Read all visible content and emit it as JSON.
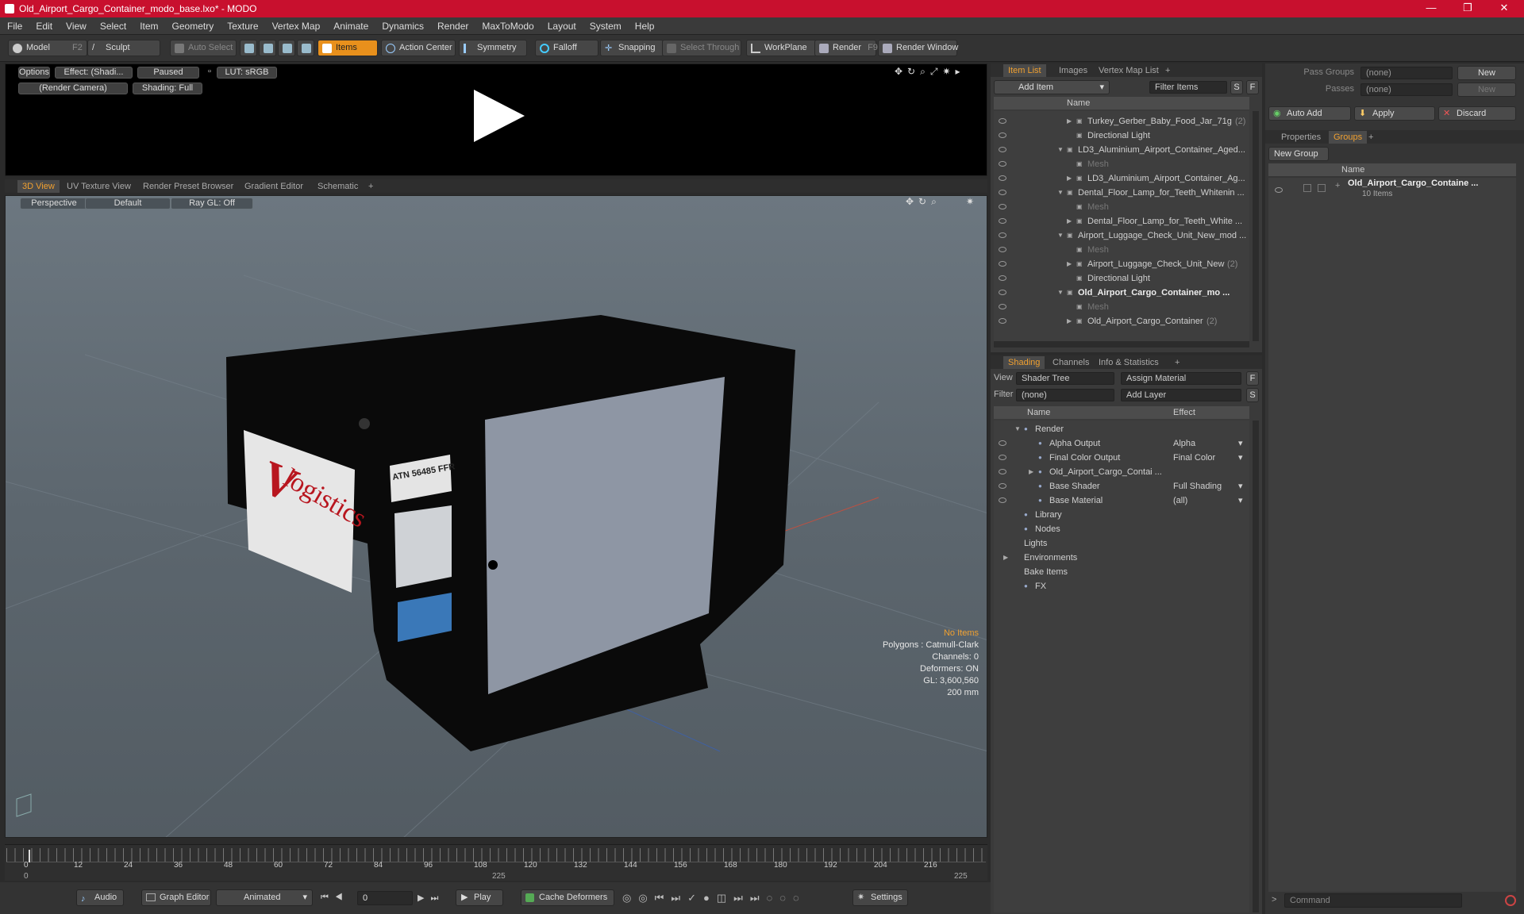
{
  "titlebar": {
    "title": "Old_Airport_Cargo_Container_modo_base.lxo* - MODO",
    "min": "—",
    "max": "❐",
    "close": "✕"
  },
  "menu": [
    "File",
    "Edit",
    "View",
    "Select",
    "Item",
    "Geometry",
    "Texture",
    "Vertex Map",
    "Animate",
    "Dynamics",
    "Render",
    "MaxToModo",
    "Layout",
    "System",
    "Help"
  ],
  "toolbar": {
    "model": "Model",
    "model_key": "F2",
    "sculpt": "Sculpt",
    "auto_select": "Auto Select",
    "items": "Items",
    "action_center": "Action Center",
    "symmetry": "Symmetry",
    "falloff": "Falloff",
    "snapping": "Snapping",
    "select_through": "Select Through",
    "workplane": "WorkPlane",
    "render": "Render",
    "render_key": "F9",
    "render_window": "Render Window"
  },
  "render_view": {
    "options": "Options",
    "effect": "Effect: (Shadi...",
    "paused": "Paused",
    "lut": "LUT: sRGB",
    "camera": "(Render Camera)",
    "shading": "Shading: Full"
  },
  "view_tabs": [
    "3D View",
    "UV Texture View",
    "Render Preset Browser",
    "Gradient Editor",
    "Schematic"
  ],
  "viewport": {
    "perspective": "Perspective",
    "default": "Default",
    "raygl": "Ray GL: Off",
    "stats": [
      "No Items",
      "Polygons : Catmull-Clark",
      "Channels: 0",
      "Deformers: ON",
      "GL: 3,600,560",
      "200 mm"
    ],
    "label_v": "V",
    "label_logistics": "logistics",
    "label_atn": "ATN 56485 FFR"
  },
  "timeline": {
    "ticks": [
      "0",
      "12",
      "24",
      "36",
      "48",
      "60",
      "72",
      "84",
      "96",
      "108",
      "120",
      "132",
      "144",
      "156",
      "168",
      "180",
      "192",
      "204",
      "216"
    ],
    "start": "0",
    "mid": "225",
    "end": "225"
  },
  "bottombar": {
    "audio": "Audio",
    "graph_editor": "Graph Editor",
    "animated": "Animated",
    "frame": "0",
    "play": "Play",
    "cache": "Cache Deformers",
    "settings": "Settings"
  },
  "itemlist": {
    "tabs": [
      "Item List",
      "Images",
      "Vertex Map List"
    ],
    "add_item": "Add Item",
    "filter": "Filter Items",
    "s": "S",
    "f": "F",
    "col_name": "Name",
    "rows": [
      {
        "label": "Turkey_Gerber_Baby_Food_Jar_71g",
        "count": "(2)",
        "indent": 2,
        "tri": "▶"
      },
      {
        "label": "Directional Light",
        "count": "",
        "indent": 2,
        "tri": ""
      },
      {
        "label": "LD3_Aluminium_Airport_Container_Aged...",
        "count": "",
        "indent": 1,
        "tri": "▼"
      },
      {
        "label": "Mesh",
        "count": "",
        "indent": 2,
        "tri": "",
        "muted": true
      },
      {
        "label": "LD3_Aluminium_Airport_Container_Ag...",
        "count": "",
        "indent": 2,
        "tri": "▶"
      },
      {
        "label": "Dental_Floor_Lamp_for_Teeth_Whitenin ...",
        "count": "",
        "indent": 1,
        "tri": "▼"
      },
      {
        "label": "Mesh",
        "count": "",
        "indent": 2,
        "tri": "",
        "muted": true
      },
      {
        "label": "Dental_Floor_Lamp_for_Teeth_White ...",
        "count": "",
        "indent": 2,
        "tri": "▶"
      },
      {
        "label": "Airport_Luggage_Check_Unit_New_mod ...",
        "count": "",
        "indent": 1,
        "tri": "▼"
      },
      {
        "label": "Mesh",
        "count": "",
        "indent": 2,
        "tri": "",
        "muted": true
      },
      {
        "label": "Airport_Luggage_Check_Unit_New",
        "count": "(2)",
        "indent": 2,
        "tri": "▶"
      },
      {
        "label": "Directional Light",
        "count": "",
        "indent": 2,
        "tri": ""
      },
      {
        "label": "Old_Airport_Cargo_Container_mo ...",
        "count": "",
        "indent": 1,
        "tri": "▼",
        "bold": true
      },
      {
        "label": "Mesh",
        "count": "",
        "indent": 2,
        "tri": "",
        "muted": true
      },
      {
        "label": "Old_Airport_Cargo_Container",
        "count": "(2)",
        "indent": 2,
        "tri": "▶"
      }
    ]
  },
  "shading": {
    "tabs": [
      "Shading",
      "Channels",
      "Info & Statistics"
    ],
    "view_label": "View",
    "view_value": "Shader Tree",
    "assign": "Assign Material",
    "f": "F",
    "filter_label": "Filter",
    "filter_value": "(none)",
    "add_layer": "Add Layer",
    "s": "S",
    "col_name": "Name",
    "col_effect": "Effect",
    "rows": [
      {
        "label": "Render",
        "effect": "",
        "indent": 1,
        "tri": "▼",
        "eye": false
      },
      {
        "label": "Alpha Output",
        "effect": "Alpha",
        "indent": 2,
        "tri": "",
        "eye": true
      },
      {
        "label": "Final Color Output",
        "effect": "Final Color",
        "indent": 2,
        "tri": "",
        "eye": true
      },
      {
        "label": "Old_Airport_Cargo_Contai ...",
        "effect": "",
        "indent": 2,
        "tri": "▶",
        "eye": true
      },
      {
        "label": "Base Shader",
        "effect": "Full Shading",
        "indent": 2,
        "tri": "",
        "eye": true
      },
      {
        "label": "Base Material",
        "effect": "(all)",
        "indent": 2,
        "tri": "",
        "eye": true
      },
      {
        "label": "Library",
        "effect": "",
        "indent": 1,
        "tri": "",
        "eye": false
      },
      {
        "label": "Nodes",
        "effect": "",
        "indent": 1,
        "tri": "",
        "eye": false
      },
      {
        "label": "Lights",
        "effect": "",
        "indent": 0,
        "tri": "",
        "eye": false
      },
      {
        "label": "Environments",
        "effect": "",
        "indent": 0,
        "tri": "▶",
        "eye": false
      },
      {
        "label": "Bake Items",
        "effect": "",
        "indent": 0,
        "tri": "",
        "eye": false
      },
      {
        "label": "FX",
        "effect": "",
        "indent": 1,
        "tri": "",
        "eye": false
      }
    ]
  },
  "rightpanel": {
    "pass_groups": "Pass Groups",
    "pass_groups_value": "(none)",
    "new": "New",
    "passes": "Passes",
    "passes_value": "(none)",
    "new2": "New",
    "auto_add": "Auto Add",
    "apply": "Apply",
    "discard": "Discard",
    "tabs": [
      "Properties",
      "Groups"
    ],
    "new_group": "New Group",
    "col_name": "Name",
    "group_name": "Old_Airport_Cargo_Containe ...",
    "group_count": "10 Items",
    "command": "Command"
  },
  "colors": {
    "accent": "#f0a030",
    "titlebar": "#c8102e"
  }
}
